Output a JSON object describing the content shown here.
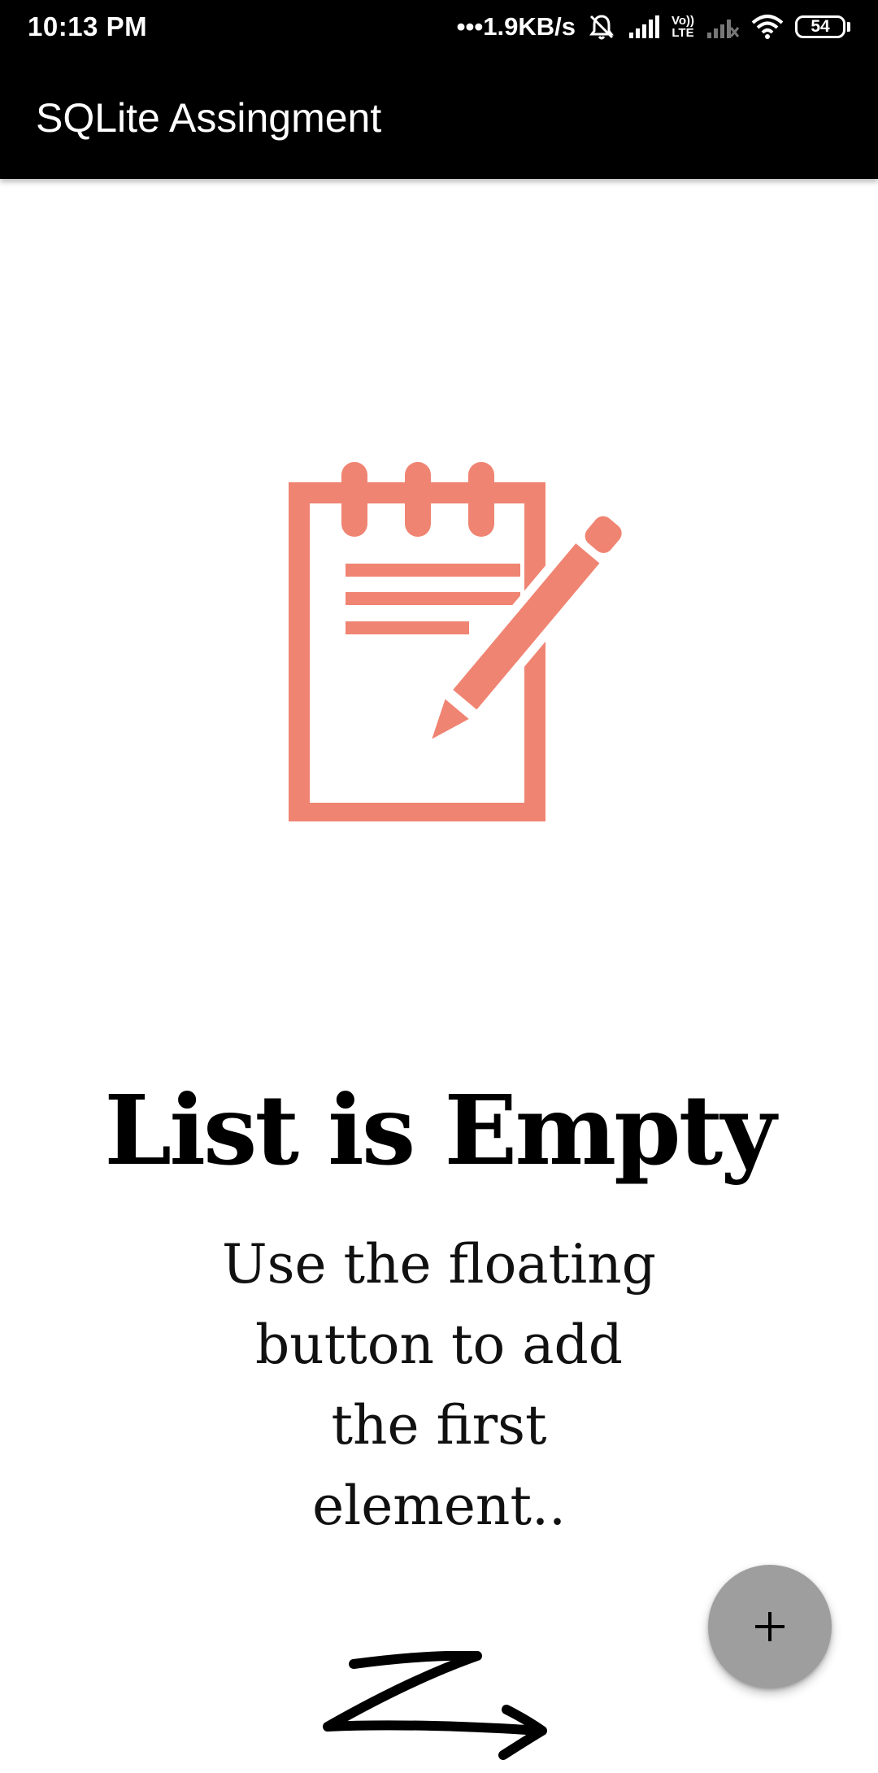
{
  "status_bar": {
    "time": "10:13 PM",
    "network_speed": "•••1.9KB/s",
    "icons": [
      "notifications-muted-icon",
      "signal-icon",
      "volte-lte-icon",
      "signal-no-service-icon",
      "wifi-icon",
      "battery-icon"
    ],
    "volte_label_top": "Vo))",
    "volte_label_bottom": "LTE",
    "battery_level": "54"
  },
  "app_bar": {
    "title": "SQLite Assingment"
  },
  "empty_state": {
    "icon": "notepad-pencil-icon",
    "icon_color": "#F08472",
    "title": "List is Empty",
    "message": "Use the floating button to add the first element..",
    "arrow_icon": "squiggle-arrow-icon"
  },
  "fab": {
    "icon": "plus-icon",
    "color": "#9E9E9E"
  }
}
